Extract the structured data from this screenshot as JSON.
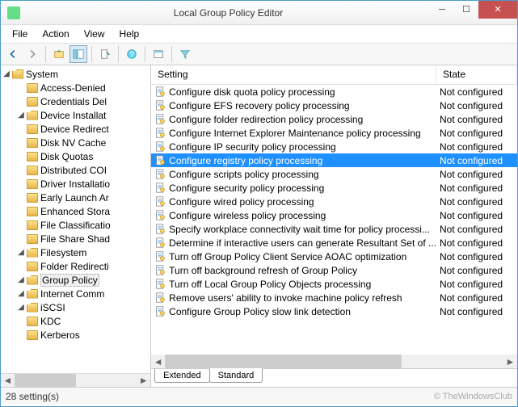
{
  "window": {
    "title": "Local Group Policy Editor"
  },
  "menu": {
    "items": [
      "File",
      "Action",
      "View",
      "Help"
    ]
  },
  "tree": {
    "root": {
      "label": "System",
      "expanded": true
    },
    "children": [
      {
        "label": "Access-Denied",
        "expanded": false,
        "depth": 1
      },
      {
        "label": "Credentials Del",
        "expanded": false,
        "depth": 1
      },
      {
        "label": "Device Installat",
        "expanded": true,
        "depth": 1
      },
      {
        "label": "Device Redirect",
        "expanded": false,
        "depth": 1
      },
      {
        "label": "Disk NV Cache",
        "expanded": false,
        "depth": 1
      },
      {
        "label": "Disk Quotas",
        "expanded": false,
        "depth": 1
      },
      {
        "label": "Distributed COI",
        "expanded": false,
        "depth": 1
      },
      {
        "label": "Driver Installatio",
        "expanded": false,
        "depth": 1
      },
      {
        "label": "Early Launch Ar",
        "expanded": false,
        "depth": 1
      },
      {
        "label": "Enhanced Stora",
        "expanded": false,
        "depth": 1
      },
      {
        "label": "File Classificatio",
        "expanded": false,
        "depth": 1
      },
      {
        "label": "File Share Shad",
        "expanded": false,
        "depth": 1
      },
      {
        "label": "Filesystem",
        "expanded": true,
        "depth": 1
      },
      {
        "label": "Folder Redirecti",
        "expanded": false,
        "depth": 1
      },
      {
        "label": "Group Policy",
        "expanded": true,
        "depth": 1,
        "selected": true
      },
      {
        "label": "Internet Comm",
        "expanded": true,
        "depth": 1
      },
      {
        "label": "iSCSI",
        "expanded": true,
        "depth": 1
      },
      {
        "label": "KDC",
        "expanded": false,
        "depth": 1
      },
      {
        "label": "Kerberos",
        "expanded": false,
        "depth": 1
      }
    ]
  },
  "list": {
    "columns": {
      "setting": "Setting",
      "state": "State"
    },
    "rows": [
      {
        "setting": "Configure disk quota policy processing",
        "state": "Not configured"
      },
      {
        "setting": "Configure EFS recovery policy processing",
        "state": "Not configured"
      },
      {
        "setting": "Configure folder redirection policy processing",
        "state": "Not configured"
      },
      {
        "setting": "Configure Internet Explorer Maintenance policy processing",
        "state": "Not configured"
      },
      {
        "setting": "Configure IP security policy processing",
        "state": "Not configured"
      },
      {
        "setting": "Configure registry policy processing",
        "state": "Not configured",
        "selected": true
      },
      {
        "setting": "Configure scripts policy processing",
        "state": "Not configured"
      },
      {
        "setting": "Configure security policy processing",
        "state": "Not configured"
      },
      {
        "setting": "Configure wired policy processing",
        "state": "Not configured"
      },
      {
        "setting": "Configure wireless policy processing",
        "state": "Not configured"
      },
      {
        "setting": "Specify workplace connectivity wait time for policy processi...",
        "state": "Not configured"
      },
      {
        "setting": "Determine if interactive users can generate Resultant Set of ...",
        "state": "Not configured"
      },
      {
        "setting": "Turn off Group Policy Client Service AOAC optimization",
        "state": "Not configured"
      },
      {
        "setting": "Turn off background refresh of Group Policy",
        "state": "Not configured"
      },
      {
        "setting": "Turn off Local Group Policy Objects processing",
        "state": "Not configured"
      },
      {
        "setting": "Remove users' ability to invoke machine policy refresh",
        "state": "Not configured"
      },
      {
        "setting": "Configure Group Policy slow link detection",
        "state": "Not configured"
      }
    ]
  },
  "tabs": {
    "extended": "Extended",
    "standard": "Standard"
  },
  "status": {
    "text": "28 setting(s)",
    "watermark": "© TheWindowsClub"
  }
}
